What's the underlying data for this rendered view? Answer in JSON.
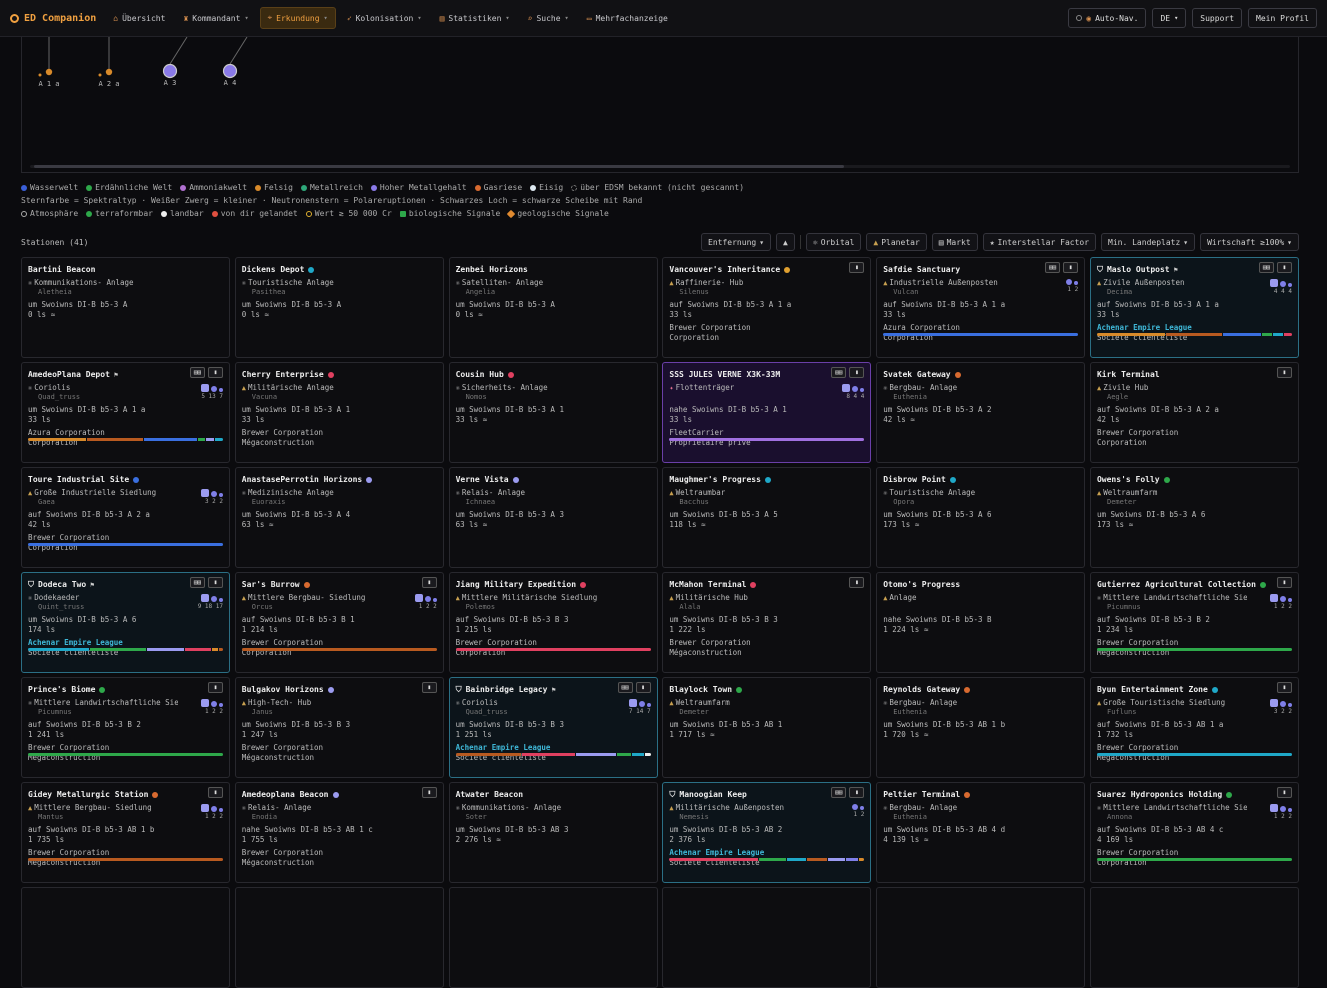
{
  "nav": {
    "app_title": "ED Companion",
    "items": [
      {
        "label": "Übersicht",
        "icon": "home-icon",
        "dropdown": false,
        "active": false
      },
      {
        "label": "Kommandant",
        "icon": "commander-icon",
        "dropdown": true,
        "active": false
      },
      {
        "label": "Erkundung",
        "icon": "telescope-icon",
        "dropdown": true,
        "active": true
      },
      {
        "label": "Kolonisation",
        "icon": "rocket-icon",
        "dropdown": true,
        "active": false
      },
      {
        "label": "Statistiken",
        "icon": "chart-icon",
        "dropdown": true,
        "active": false
      },
      {
        "label": "Suche",
        "icon": "search-icon",
        "dropdown": true,
        "active": false
      },
      {
        "label": "Mehrfachanzeige",
        "icon": "monitor-icon",
        "dropdown": false,
        "active": false
      }
    ],
    "autonav_label": "Auto-Nav.",
    "lang": "DE",
    "support_label": "Support",
    "profile_label": "Mein Profil"
  },
  "map": {
    "bodies": [
      {
        "label": "A 1 a",
        "kind": "small"
      },
      {
        "label": "A 2 a",
        "kind": "small"
      },
      {
        "label": "A 3",
        "kind": "large"
      },
      {
        "label": "A 4",
        "kind": "large"
      }
    ]
  },
  "legend": {
    "row1": [
      {
        "label": "Wasserwelt",
        "color": "#3a5fd8"
      },
      {
        "label": "Erdähnliche Welt",
        "color": "#2ea84a"
      },
      {
        "label": "Ammoniakwelt",
        "color": "#b070d0"
      },
      {
        "label": "Felsig",
        "color": "#d88a2a"
      },
      {
        "label": "Metallreich",
        "color": "#2ea87a"
      },
      {
        "label": "Hoher Metallgehalt",
        "color": "#8a7ae8"
      },
      {
        "label": "Gasriese",
        "color": "#d86a30"
      },
      {
        "label": "Eisig",
        "color": "#dde8f0"
      },
      {
        "label": "über EDSM bekannt (nicht gescannt)",
        "color": "#555555"
      }
    ],
    "row2": "Sternfarbe = Spektraltyp · Weißer Zwerg = kleiner · Neutronenstern = Polareruptionen · Schwarzes Loch = schwarze Scheibe mit Rand",
    "row3": [
      {
        "label": "Atmosphäre",
        "icon": "ring-icon"
      },
      {
        "label": "terraformbar",
        "icon": "green-dot-icon"
      },
      {
        "label": "landbar",
        "icon": "white-dot-icon"
      },
      {
        "label": "von dir gelandet",
        "icon": "red-dot-icon"
      },
      {
        "label": "Wert ≳ 50 000 Cr",
        "icon": "gold-ring-icon"
      },
      {
        "label": "biologische Signale",
        "icon": "bio-icon"
      },
      {
        "label": "geologische Signale",
        "icon": "geo-icon"
      }
    ]
  },
  "stations_title": "Stationen (41)",
  "filters": {
    "sort": "Entfernung",
    "orbital": "Orbital",
    "planetar": "Planetar",
    "markt": "Markt",
    "interstellar": "Interstellar Factor",
    "landeplatz": "Min. Landeplatz",
    "wirtschaft": "Wirtschaft ≥100%"
  },
  "stations": [
    {
      "name": "Bartini Beacon",
      "dot": "",
      "flag": false,
      "shield": false,
      "type": "Kommunikations- Anlage",
      "gov": "Aletheia",
      "dist": "um Swoiwns DI-B b5-3 A",
      "ls": "0 ls ≈",
      "fac1": "",
      "fac2": "",
      "league": false,
      "badges": 0,
      "pads": "",
      "bar": [],
      "variant": ""
    },
    {
      "name": "Dickens Depot",
      "dot": "#1fa8c8",
      "flag": false,
      "shield": false,
      "type": "Touristische Anlage",
      "gov": "Pasithea",
      "dist": "um Swoiwns DI-B b5-3 A",
      "ls": "0 ls ≈",
      "fac1": "",
      "fac2": "",
      "league": false,
      "badges": 0,
      "pads": "",
      "bar": [],
      "variant": ""
    },
    {
      "name": "Zenbei Horizons",
      "dot": "",
      "flag": false,
      "shield": false,
      "type": "Satelliten- Anlage",
      "gov": "Angelia",
      "dist": "um Swoiwns DI-B b5-3 A",
      "ls": "0 ls ≈",
      "fac1": "",
      "fac2": "",
      "league": false,
      "badges": 0,
      "pads": "",
      "bar": [],
      "variant": ""
    },
    {
      "name": "Vancouver's Inheritance",
      "dot": "#e0a030",
      "flag": false,
      "shield": false,
      "type": "Raffinerie- Hub",
      "gov": "Silenus",
      "dist": "auf Swoiwns DI-B b5-3 A 1 a",
      "ls": "33 ls",
      "fac1": "Brewer Corporation",
      "fac2": "Corporation",
      "league": false,
      "badges": 1,
      "pads": "",
      "bar": [],
      "variant": ""
    },
    {
      "name": "Safdie Sanctuary",
      "dot": "",
      "flag": false,
      "shield": false,
      "type": "Industrielle Außenposten",
      "gov": "Vulcan",
      "dist": "auf Swoiwns DI-B b5-3 A 1 a",
      "ls": "33 ls",
      "fac1": "Azura Corporation",
      "fac2": "Corporation",
      "league": false,
      "badges": 2,
      "pads": "1 2",
      "bar": [
        [
          "#3a6fe0",
          100
        ]
      ],
      "variant": ""
    },
    {
      "name": "Maslo Outpost",
      "dot": "",
      "flag": true,
      "shield": true,
      "type": "Zivile Außenposten",
      "gov": "Decima",
      "dist": "auf Swoiwns DI-B b5-3 A 1 a",
      "ls": "33 ls",
      "fac1": "Achenar Empire League",
      "fac2": "Société clientéliste",
      "league": true,
      "badges": 2,
      "pads": "4 4 4",
      "bar": [
        [
          "#d88a2a",
          34
        ],
        [
          "#b85a20",
          28
        ],
        [
          "#3a6fe0",
          19
        ],
        [
          "#2ea84a",
          5
        ],
        [
          "#1fa8c8",
          5
        ],
        [
          "#e04060",
          4
        ]
      ],
      "variant": "league"
    },
    {
      "name": "AmedeoPlana Depot",
      "dot": "",
      "flag": true,
      "shield": false,
      "type": "Coriolis",
      "gov": "Quad_truss",
      "dist": "um Swoiwns DI-B b5-3 A 1 a",
      "ls": "33 ls",
      "fac1": "Azura Corporation",
      "fac2": "Corporation",
      "league": false,
      "badges": 2,
      "pads": "5 13 7",
      "bar": [
        [
          "#d88a2a",
          30
        ],
        [
          "#b85a20",
          29
        ],
        [
          "#3a6fe0",
          27
        ],
        [
          "#2ea84a",
          4
        ],
        [
          "#9b9bf0",
          4
        ],
        [
          "#1fa8c8",
          4
        ]
      ],
      "variant": ""
    },
    {
      "name": "Cherry Enterprise",
      "dot": "#e04060",
      "flag": false,
      "shield": false,
      "type": "Militärische Anlage",
      "gov": "Vacuna",
      "dist": "um Swoiwns DI-B b5-3 A 1",
      "ls": "33 ls",
      "fac1": "Brewer Corporation",
      "fac2": "Mégaconstruction",
      "league": false,
      "badges": 0,
      "pads": "",
      "bar": [],
      "variant": ""
    },
    {
      "name": "Cousin Hub",
      "dot": "#e04060",
      "flag": false,
      "shield": false,
      "type": "Sicherheits- Anlage",
      "gov": "Nomos",
      "dist": "um Swoiwns DI-B b5-3 A 1",
      "ls": "33 ls ≈",
      "fac1": "",
      "fac2": "",
      "league": false,
      "badges": 0,
      "pads": "",
      "bar": [],
      "variant": ""
    },
    {
      "name": "SSS JULES VERNE X3K-33M",
      "dot": "",
      "flag": false,
      "shield": false,
      "type": "Flottenträger",
      "gov": "",
      "dist": "nahe Swoiwns DI-B b5-3 A 1",
      "ls": "33 ls",
      "fac1": "FleetCarrier",
      "fac2": "Propriétaire privé",
      "league": false,
      "badges": 2,
      "pads": "8 4 4",
      "bar": [
        [
          "#a070e0",
          100
        ]
      ],
      "variant": "carrier"
    },
    {
      "name": "Svatek Gateway",
      "dot": "#d86a30",
      "flag": false,
      "shield": false,
      "type": "Bergbau- Anlage",
      "gov": "Euthenia",
      "dist": "um Swoiwns DI-B b5-3 A 2",
      "ls": "42 ls ≈",
      "fac1": "",
      "fac2": "",
      "league": false,
      "badges": 0,
      "pads": "",
      "bar": [],
      "variant": ""
    },
    {
      "name": "Kirk Terminal",
      "dot": "",
      "flag": false,
      "shield": false,
      "type": "Zivile Hub",
      "gov": "Aegle",
      "dist": "auf Swoiwns DI-B b5-3 A 2 a",
      "ls": "42 ls",
      "fac1": "Brewer Corporation",
      "fac2": "Corporation",
      "league": false,
      "badges": 1,
      "pads": "",
      "bar": [],
      "variant": ""
    },
    {
      "name": "Toure Industrial Site",
      "dot": "#3a6fe0",
      "flag": false,
      "shield": false,
      "type": "Große Industrielle Siedlung",
      "gov": "Gaea",
      "dist": "auf Swoiwns DI-B b5-3 A 2 a",
      "ls": "42 ls",
      "fac1": "Brewer Corporation",
      "fac2": "Corporation",
      "league": false,
      "badges": 0,
      "pads": "3 2 2",
      "bar": [
        [
          "#3a6fe0",
          100
        ]
      ],
      "variant": ""
    },
    {
      "name": "AnastasePerrotin Horizons",
      "dot": "#9b9bf0",
      "flag": false,
      "shield": false,
      "type": "Medizinische Anlage",
      "gov": "Euoraxis",
      "dist": "um Swoiwns DI-B b5-3 A 4",
      "ls": "63 ls ≈",
      "fac1": "",
      "fac2": "",
      "league": false,
      "badges": 0,
      "pads": "",
      "bar": [],
      "variant": ""
    },
    {
      "name": "Verne Vista",
      "dot": "#9b9bf0",
      "flag": false,
      "shield": false,
      "type": "Relais- Anlage",
      "gov": "Ichnaea",
      "dist": "um Swoiwns DI-B b5-3 A 3",
      "ls": "63 ls ≈",
      "fac1": "",
      "fac2": "",
      "league": false,
      "badges": 0,
      "pads": "",
      "bar": [],
      "variant": ""
    },
    {
      "name": "Maughmer's Progress",
      "dot": "#1fa8c8",
      "flag": false,
      "shield": false,
      "type": "Weltraumbar",
      "gov": "Bacchus",
      "dist": "um Swoiwns DI-B b5-3 A 5",
      "ls": "118 ls ≈",
      "fac1": "",
      "fac2": "",
      "league": false,
      "badges": 0,
      "pads": "",
      "bar": [],
      "variant": ""
    },
    {
      "name": "Disbrow Point",
      "dot": "#1fa8c8",
      "flag": false,
      "shield": false,
      "type": "Touristische Anlage",
      "gov": "Opora",
      "dist": "um Swoiwns DI-B b5-3 A 6",
      "ls": "173 ls ≈",
      "fac1": "",
      "fac2": "",
      "league": false,
      "badges": 0,
      "pads": "",
      "bar": [],
      "variant": ""
    },
    {
      "name": "Owens's Folly",
      "dot": "#2ea84a",
      "flag": false,
      "shield": false,
      "type": "Weltraumfarm",
      "gov": "Demeter",
      "dist": "um Swoiwns DI-B b5-3 A 6",
      "ls": "173 ls ≈",
      "fac1": "",
      "fac2": "",
      "league": false,
      "badges": 0,
      "pads": "",
      "bar": [],
      "variant": ""
    },
    {
      "name": "Dodeca Two",
      "dot": "",
      "flag": true,
      "shield": true,
      "type": "Dodekaeder",
      "gov": "Quint_truss",
      "dist": "um Swoiwns DI-B b5-3 A 6",
      "ls": "174 ls",
      "fac1": "Achenar Empire League",
      "fac2": "Société clientéliste",
      "league": true,
      "badges": 2,
      "pads": "9 18 17",
      "bar": [
        [
          "#1fa8c8",
          31
        ],
        [
          "#2ea84a",
          28
        ],
        [
          "#9b9bf0",
          19
        ],
        [
          "#e04060",
          13
        ],
        [
          "#d88a2a",
          3
        ],
        [
          "#b85a20",
          2
        ]
      ],
      "variant": "league"
    },
    {
      "name": "Sar's Burrow",
      "dot": "#d86a30",
      "flag": false,
      "shield": false,
      "type": "Mittlere Bergbau- Siedlung",
      "gov": "Orcus",
      "dist": "auf Swoiwns DI-B b5-3 B 1",
      "ls": "1 214 ls",
      "fac1": "Brewer Corporation",
      "fac2": "Corporation",
      "league": false,
      "badges": 1,
      "pads": "1 2 2",
      "bar": [
        [
          "#b85a20",
          100
        ]
      ],
      "variant": ""
    },
    {
      "name": "Jiang Military Expedition",
      "dot": "#e04060",
      "flag": false,
      "shield": false,
      "type": "Mittlere Militärische Siedlung",
      "gov": "Polemos",
      "dist": "auf Swoiwns DI-B b5-3 B 3",
      "ls": "1 215 ls",
      "fac1": "Brewer Corporation",
      "fac2": "Corporation",
      "league": false,
      "badges": 0,
      "pads": "",
      "bar": [
        [
          "#e04060",
          100
        ]
      ],
      "variant": ""
    },
    {
      "name": "McMahon Terminal",
      "dot": "#e04060",
      "flag": false,
      "shield": false,
      "type": "Militärische Hub",
      "gov": "Alala",
      "dist": "um Swoiwns DI-B b5-3 B 3",
      "ls": "1 222 ls",
      "fac1": "Brewer Corporation",
      "fac2": "Mégaconstruction",
      "league": false,
      "badges": 1,
      "pads": "",
      "bar": [],
      "variant": ""
    },
    {
      "name": "Otomo's Progress",
      "dot": "",
      "flag": false,
      "shield": false,
      "type": "Anlage",
      "gov": "",
      "dist": "nahe Swoiwns DI-B b5-3 B",
      "ls": "1 224 ls ≈",
      "fac1": "",
      "fac2": "",
      "league": false,
      "badges": 0,
      "pads": "",
      "bar": [],
      "variant": ""
    },
    {
      "name": "Gutierrez Agricultural Collection",
      "dot": "#2ea84a",
      "flag": false,
      "shield": false,
      "type": "Mittlere Landwirtschaftliche Sied…",
      "gov": "Picumnus",
      "dist": "auf Swoiwns DI-B b5-3 B 2",
      "ls": "1 234 ls",
      "fac1": "Brewer Corporation",
      "fac2": "Mégaconstruction",
      "league": false,
      "badges": 1,
      "pads": "1 2 2",
      "bar": [
        [
          "#2ea84a",
          100
        ]
      ],
      "variant": ""
    },
    {
      "name": "Prince's Biome",
      "dot": "#2ea84a",
      "flag": false,
      "shield": false,
      "type": "Mittlere Landwirtschaftliche Sied…",
      "gov": "Picumnus",
      "dist": "auf Swoiwns DI-B b5-3 B 2",
      "ls": "1 241 ls",
      "fac1": "Brewer Corporation",
      "fac2": "Mégaconstruction",
      "league": false,
      "badges": 1,
      "pads": "1 2 2",
      "bar": [
        [
          "#2ea84a",
          100
        ]
      ],
      "variant": ""
    },
    {
      "name": "Bulgakov Horizons",
      "dot": "#9b9bf0",
      "flag": false,
      "shield": false,
      "type": "High-Tech- Hub",
      "gov": "Janus",
      "dist": "um Swoiwns DI-B b5-3 B 3",
      "ls": "1 247 ls",
      "fac1": "Brewer Corporation",
      "fac2": "Mégaconstruction",
      "league": false,
      "badges": 1,
      "pads": "",
      "bar": [],
      "variant": ""
    },
    {
      "name": "Bainbridge Legacy",
      "dot": "",
      "flag": true,
      "shield": true,
      "type": "Coriolis",
      "gov": "Quad_truss",
      "dist": "um Swoiwns DI-B b5-3 B 3",
      "ls": "1 251 ls",
      "fac1": "Achenar Empire League",
      "fac2": "Société clientéliste",
      "league": true,
      "badges": 2,
      "pads": "7 14 7",
      "bar": [
        [
          "#b85a20",
          33
        ],
        [
          "#e04060",
          27
        ],
        [
          "#9b9bf0",
          20
        ],
        [
          "#2ea84a",
          7
        ],
        [
          "#1fa8c8",
          6
        ],
        [
          "#eeeeee",
          3
        ]
      ],
      "variant": "league"
    },
    {
      "name": "Blaylock Town",
      "dot": "#2ea84a",
      "flag": false,
      "shield": false,
      "type": "Weltraumfarm",
      "gov": "Demeter",
      "dist": "um Swoiwns DI-B b5-3 AB 1",
      "ls": "1 717 ls ≈",
      "fac1": "",
      "fac2": "",
      "league": false,
      "badges": 0,
      "pads": "",
      "bar": [],
      "variant": ""
    },
    {
      "name": "Reynolds Gateway",
      "dot": "#d86a30",
      "flag": false,
      "shield": false,
      "type": "Bergbau- Anlage",
      "gov": "Euthenia",
      "dist": "um Swoiwns DI-B b5-3 AB 1 b",
      "ls": "1 720 ls ≈",
      "fac1": "",
      "fac2": "",
      "league": false,
      "badges": 0,
      "pads": "",
      "bar": [],
      "variant": ""
    },
    {
      "name": "Byun Entertainment Zone",
      "dot": "#1fa8c8",
      "flag": false,
      "shield": false,
      "type": "Große Touristische Siedlung",
      "gov": "Fufluns",
      "dist": "auf Swoiwns DI-B b5-3 AB 1 a",
      "ls": "1 732 ls",
      "fac1": "Brewer Corporation",
      "fac2": "Mégaconstruction",
      "league": false,
      "badges": 1,
      "pads": "3 2 2",
      "bar": [
        [
          "#1fa8c8",
          100
        ]
      ],
      "variant": ""
    },
    {
      "name": "Gidey Metallurgic Station",
      "dot": "#d86a30",
      "flag": false,
      "shield": false,
      "type": "Mittlere Bergbau- Siedlung",
      "gov": "Mantus",
      "dist": "auf Swoiwns DI-B b5-3 AB 1 b",
      "ls": "1 735 ls",
      "fac1": "Brewer Corporation",
      "fac2": "Mégaconstruction",
      "league": false,
      "badges": 1,
      "pads": "1 2 2",
      "bar": [
        [
          "#b85a20",
          100
        ]
      ],
      "variant": ""
    },
    {
      "name": "Amedeoplana Beacon",
      "dot": "#9b9bf0",
      "flag": false,
      "shield": false,
      "type": "Relais- Anlage",
      "gov": "Enodia",
      "dist": "nahe Swoiwns DI-B b5-3 AB 1 c",
      "ls": "1 755 ls",
      "fac1": "Brewer Corporation",
      "fac2": "Mégaconstruction",
      "league": false,
      "badges": 1,
      "pads": "",
      "bar": [],
      "variant": ""
    },
    {
      "name": "Atwater Beacon",
      "dot": "",
      "flag": false,
      "shield": false,
      "type": "Kommunikations- Anlage",
      "gov": "Soter",
      "dist": "um Swoiwns DI-B b5-3 AB 3",
      "ls": "2 276 ls ≈",
      "fac1": "",
      "fac2": "",
      "league": false,
      "badges": 0,
      "pads": "",
      "bar": [],
      "variant": ""
    },
    {
      "name": "Manoogian Keep",
      "dot": "",
      "flag": false,
      "shield": true,
      "type": "Militärische Außenposten",
      "gov": "Nemesis",
      "dist": "um Swoiwns DI-B b5-3 AB 2",
      "ls": "2 376 ls",
      "fac1": "Achenar Empire League",
      "fac2": "Société clientéliste",
      "league": true,
      "badges": 2,
      "pads": "1 2",
      "bar": [
        [
          "#e04060",
          46
        ],
        [
          "#2ea84a",
          14
        ],
        [
          "#1fa8c8",
          10
        ],
        [
          "#b85a20",
          10
        ],
        [
          "#9b9bf0",
          9
        ],
        [
          "#7f7fe8",
          6
        ],
        [
          "#d88a2a",
          3
        ]
      ],
      "variant": "league"
    },
    {
      "name": "Peltier Terminal",
      "dot": "#d86a30",
      "flag": false,
      "shield": false,
      "type": "Bergbau- Anlage",
      "gov": "Euthenia",
      "dist": "um Swoiwns DI-B b5-3 AB 4 d",
      "ls": "4 139 ls ≈",
      "fac1": "",
      "fac2": "",
      "league": false,
      "badges": 0,
      "pads": "",
      "bar": [],
      "variant": ""
    },
    {
      "name": "Suarez Hydroponics Holding",
      "dot": "#2ea84a",
      "flag": false,
      "shield": false,
      "type": "Mittlere Landwirtschaftliche Sied…",
      "gov": "Annona",
      "dist": "auf Swoiwns DI-B b5-3 AB 4 c",
      "ls": "4 169 ls",
      "fac1": "Brewer Corporation",
      "fac2": "Corporation",
      "league": false,
      "badges": 1,
      "pads": "1 2 2",
      "bar": [
        [
          "#2ea84a",
          100
        ]
      ],
      "variant": ""
    }
  ]
}
